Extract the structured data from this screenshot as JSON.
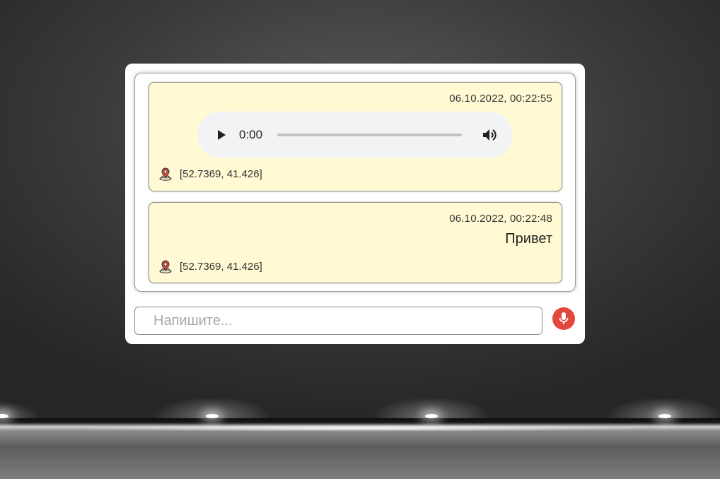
{
  "messages": [
    {
      "timestamp": "06.10.2022, 00:22:55",
      "type": "audio",
      "audio": {
        "time": "0:00",
        "progress": 0
      },
      "location": "[52.7369, 41.426]"
    },
    {
      "timestamp": "06.10.2022, 00:22:48",
      "type": "text",
      "text": "Привет",
      "location": "[52.7369, 41.426]"
    }
  ],
  "composer": {
    "placeholder": "Напишите...",
    "value": ""
  },
  "icons": {
    "location": "map-pin-icon",
    "play": "play-icon",
    "volume": "volume-icon",
    "mic": "microphone-icon"
  },
  "colors": {
    "message_bg": "#fffad4",
    "mic_button": "#e2483d",
    "audio_player_bg": "#f1f3f4"
  }
}
